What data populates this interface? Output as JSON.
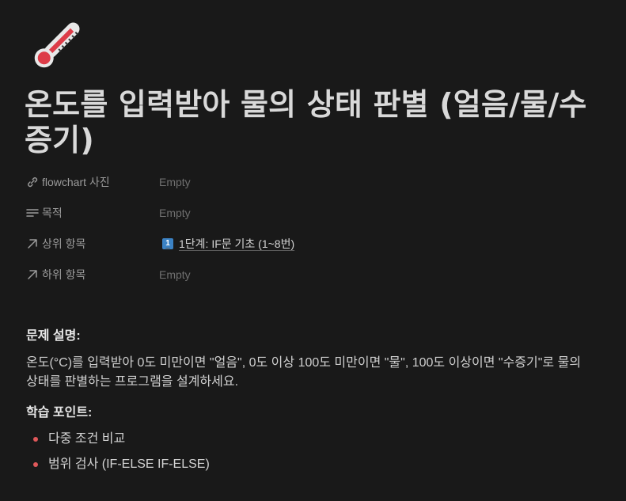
{
  "page": {
    "icon": "thermometer-icon",
    "title": "온도를 입력받아 물의 상태 판별 (얼음/물/수증기)"
  },
  "properties": [
    {
      "icon": "link-icon",
      "name": "flowchart 사진",
      "value": "Empty"
    },
    {
      "icon": "text-lines-icon",
      "name": "목적",
      "value": "Empty"
    },
    {
      "icon": "arrow-up-right-icon",
      "name": "상위 항목",
      "value": "1단계: IF문 기초 (1~8번)",
      "badge": "1"
    },
    {
      "icon": "arrow-up-right-icon",
      "name": "하위 항목",
      "value": "Empty"
    }
  ],
  "content": {
    "problem_heading": "문제 설명:",
    "problem_text": "온도(°C)를 입력받아 0도 미만이면 \"얼음\", 0도 이상 100도 미만이면 \"물\", 100도 이상이면 \"수증기\"로 물의 상태를 판별하는 프로그램을 설계하세요.",
    "learning_heading": "학습 포인트:",
    "learning_points": [
      "다중 조건 비교",
      "범위 검사 (IF-ELSE IF-ELSE)"
    ]
  },
  "colors": {
    "background": "#191919",
    "bullet": "#e0585a",
    "badge": "#3b82c4"
  }
}
